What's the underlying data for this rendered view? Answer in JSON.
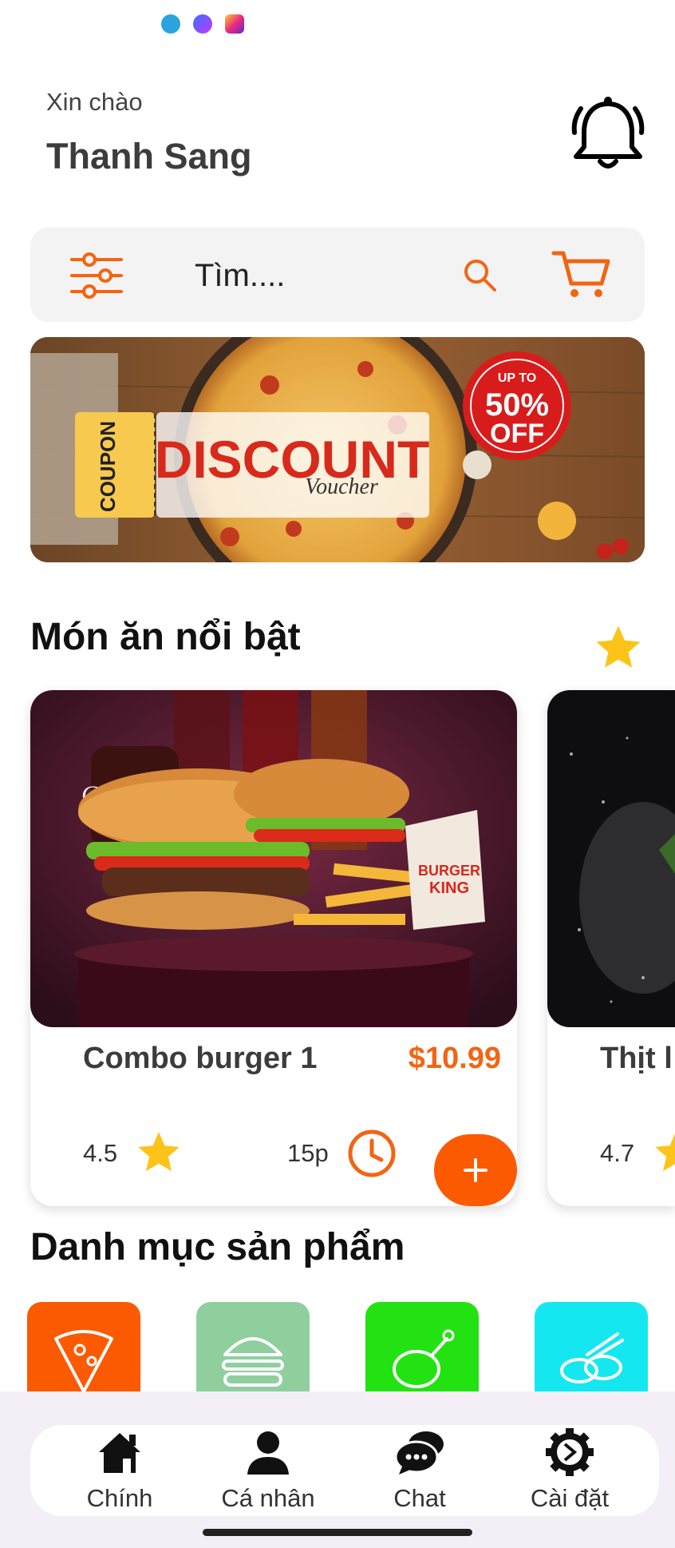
{
  "status_bar": {
    "icons": [
      "telegram-icon",
      "messenger-icon",
      "instagram-icon"
    ]
  },
  "header": {
    "greeting": "Xin chào",
    "username": "Thanh Sang"
  },
  "search": {
    "placeholder": "Tìm...."
  },
  "banner": {
    "coupon_label": "COUPON",
    "headline": "DISCOUNT",
    "subline": "Voucher",
    "badge_top": "UP TO",
    "badge_value": "50%",
    "badge_bottom": "OFF"
  },
  "featured": {
    "title": "Món ăn nổi bật",
    "items": [
      {
        "name": "Combo burger 1",
        "price": "$10.99",
        "rating": "4.5",
        "time": "15p",
        "add_label": "+",
        "logo_text_1": "BURGER",
        "logo_text_2": "KING",
        "cola_text": "Coca-Cola"
      },
      {
        "name": "Thịt l",
        "rating": "4.7"
      }
    ]
  },
  "categories": {
    "title": "Danh mục sản phẩm",
    "items": [
      {
        "icon": "pizza-icon",
        "color": "#fb5a00"
      },
      {
        "icon": "burger-icon",
        "color": "#8fcf9e"
      },
      {
        "icon": "chicken-icon",
        "color": "#22e311"
      },
      {
        "icon": "sushi-icon",
        "color": "#14e7f0"
      }
    ]
  },
  "bottom_nav": {
    "items": [
      {
        "label": "Chính",
        "icon": "home-icon"
      },
      {
        "label": "Cá nhân",
        "icon": "person-icon"
      },
      {
        "label": "Chat",
        "icon": "chat-icon"
      },
      {
        "label": "Cài đặt",
        "icon": "gear-icon"
      }
    ]
  },
  "colors": {
    "accent": "#f26512",
    "add_button": "#fb5a00",
    "star": "#fcc419"
  }
}
